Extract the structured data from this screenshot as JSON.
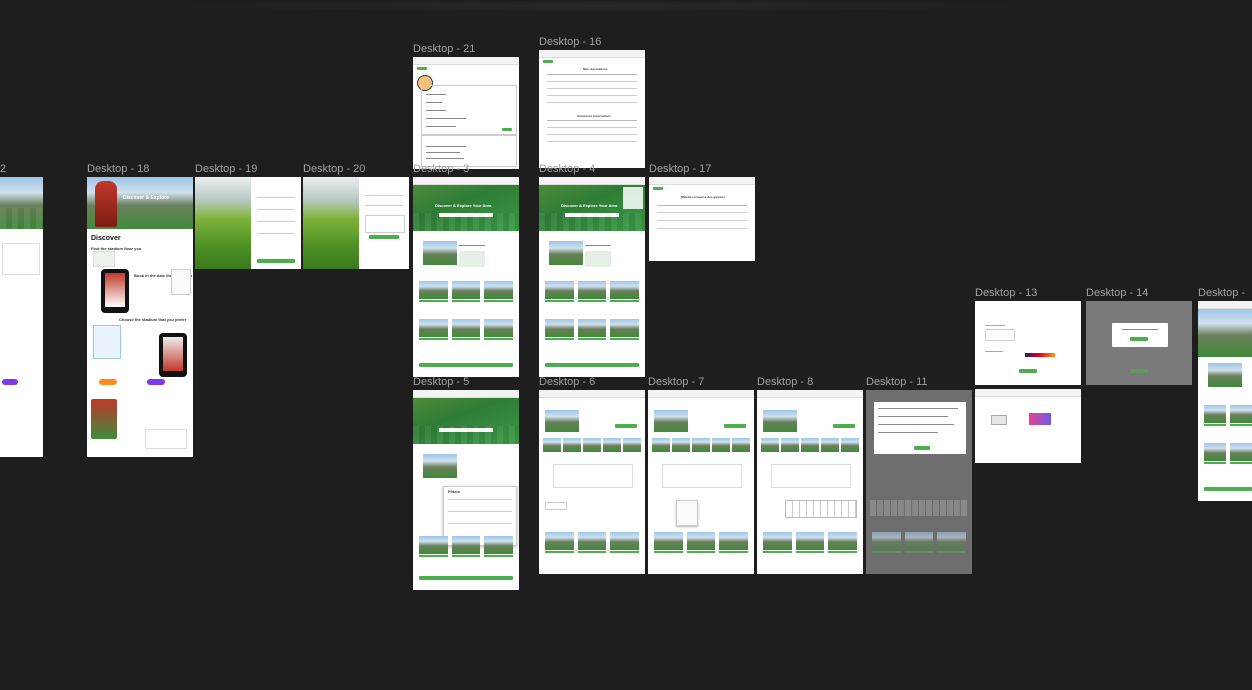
{
  "canvas": {
    "background": "#1e1e1e",
    "accent": "#4cae4c",
    "label_color": "#a0a0a0"
  },
  "frames": {
    "f12": {
      "label": "2"
    },
    "f18": {
      "label": "Desktop - 18",
      "heading": "Discover",
      "step1": "Find the stadium Near you",
      "step2": "Book in the date that suits you",
      "step3": "Choose the stadium that you prefer",
      "hero": "Discover & Explore"
    },
    "f19": {
      "label": "Desktop - 19"
    },
    "f20": {
      "label": "Desktop - 20"
    },
    "f21": {
      "label": "Desktop - 21"
    },
    "f16": {
      "label": "Desktop - 16",
      "title1": "Mes réservations",
      "title2": "Anciennes réservations"
    },
    "f3": {
      "label": "Desktop - 3",
      "hero_title": "Discover & Explore Your Area"
    },
    "f4": {
      "label": "Desktop - 4",
      "hero_title": "Discover & Explore Your Area"
    },
    "f17": {
      "label": "Desktop - 17",
      "title": "Matchs en bourse des garçons"
    },
    "f13": {
      "label": "Desktop - 13"
    },
    "f14": {
      "label": "Desktop - 14"
    },
    "fedge": {
      "label": "Desktop -"
    },
    "f5": {
      "label": "Desktop - 5",
      "filters": "Filters"
    },
    "f6": {
      "label": "Desktop - 6"
    },
    "f7": {
      "label": "Desktop - 7"
    },
    "f8": {
      "label": "Desktop - 8"
    },
    "f11": {
      "label": "Desktop - 11"
    }
  }
}
